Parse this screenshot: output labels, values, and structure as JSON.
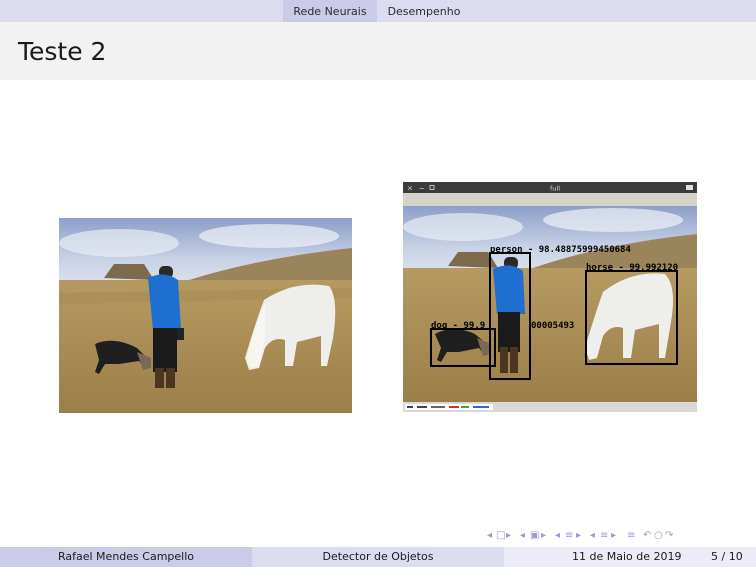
{
  "nav": {
    "section_1": "Rede Neurais",
    "section_2": "Desempenho"
  },
  "slide": {
    "title": "Teste 2"
  },
  "detection_window": {
    "window_title": "full",
    "labels": [
      {
        "text": "person - 98.48875999450684"
      },
      {
        "text": "horse - 99.992120"
      },
      {
        "text": "dog - 99.9"
      },
      {
        "text": "00005493"
      }
    ]
  },
  "footer": {
    "author": "Rafael Mendes Campello",
    "short_title": "Detector de Objetos",
    "date": "11 de Maio de 2019",
    "page": "5 / 10"
  },
  "colors": {
    "nav_bg": "#dcdcf1",
    "nav_active": "#cacae9",
    "title_bg": "#f2f2f2",
    "footer_dark": "#cacae9",
    "footer_mid": "#dcdcf1",
    "footer_light": "#ececf8"
  }
}
